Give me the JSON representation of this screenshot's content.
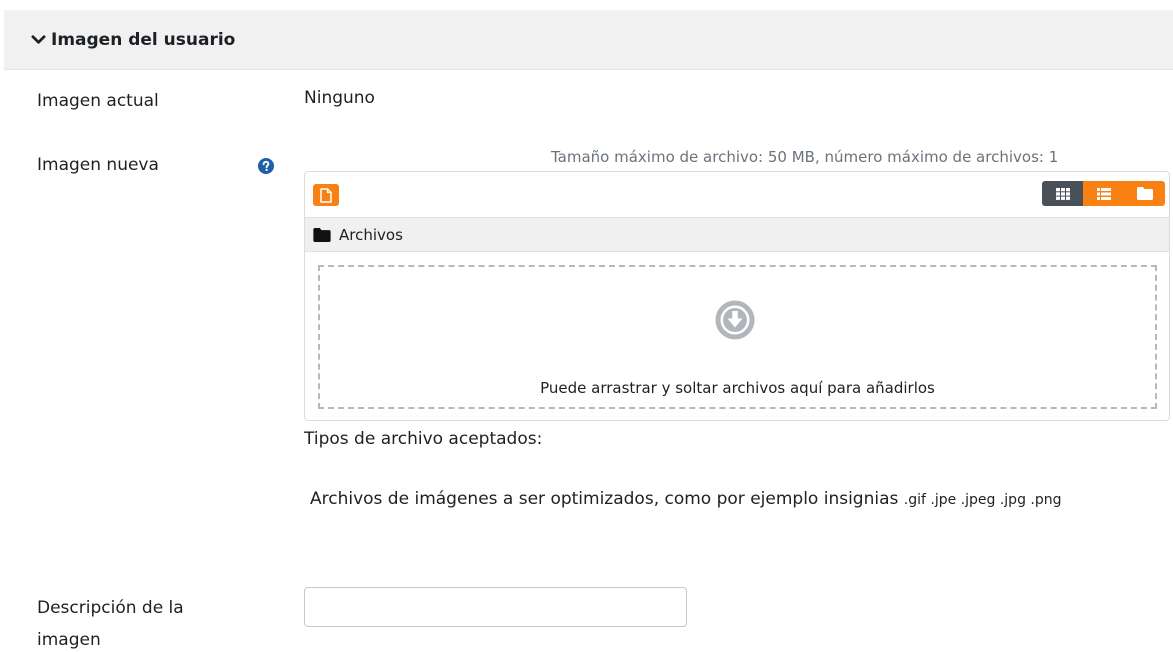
{
  "section": {
    "title": "Imagen del usuario",
    "chevron_icon": "chevron-down-icon"
  },
  "current_image": {
    "label": "Imagen actual",
    "value": "Ninguno"
  },
  "new_image": {
    "label": "Imagen nueva",
    "help_icon": "question-circle-icon",
    "limit_note": "Tamaño máximo de archivo: 50 MB, número máximo de archivos: 1",
    "filepicker": {
      "add_icon": "file-add-icon",
      "view_buttons": [
        "grid-view-icon",
        "list-view-icon",
        "folder-view-icon"
      ],
      "path_icon": "folder-icon",
      "path_label": "Archivos",
      "drop_icon": "arrow-circle-down-icon",
      "drop_text": "Puede arrastrar y soltar archivos aquí para añadirlos"
    },
    "accepted_title": "Tipos de archivo aceptados:",
    "accepted_desc": "Archivos de imágenes a ser optimizados, como por ejemplo insignias",
    "accepted_extensions": ".gif .jpe .jpeg .jpg .png"
  },
  "image_description": {
    "label_line1": "Descripción de la",
    "label_line2": "imagen",
    "value": ""
  },
  "colors": {
    "accent": "#f98012",
    "dark_button": "#495057",
    "header_bg": "#f1f1f1",
    "help_icon": "#1f5ea8",
    "drop_icon": "#b0b6bb"
  }
}
